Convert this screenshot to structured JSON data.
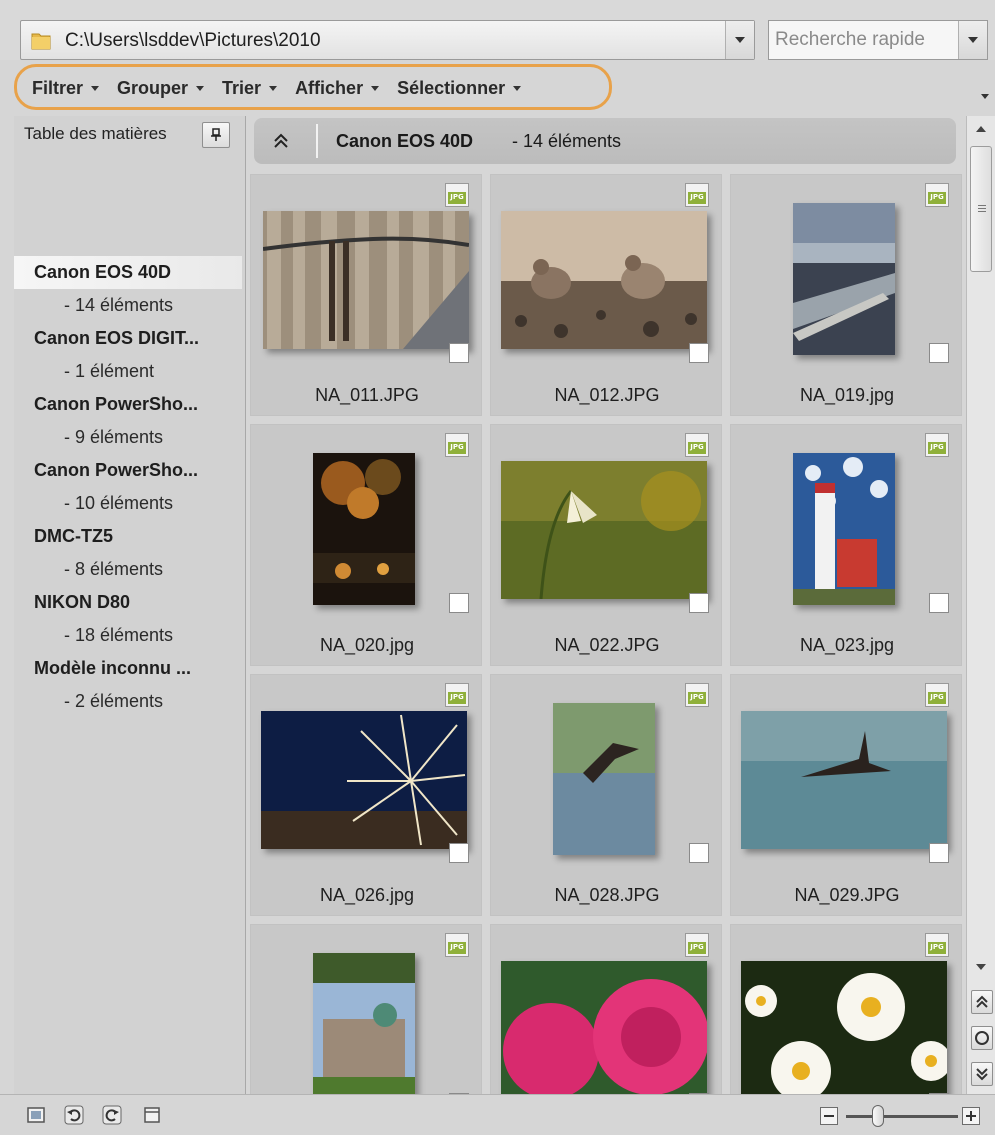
{
  "path_bar": {
    "path": "C:\\Users\\lsddev\\Pictures\\2010"
  },
  "search": {
    "placeholder": "Recherche rapide"
  },
  "toolbar": {
    "items": [
      {
        "label": "Filtrer"
      },
      {
        "label": "Grouper"
      },
      {
        "label": "Trier"
      },
      {
        "label": "Afficher"
      },
      {
        "label": "Sélectionner"
      }
    ]
  },
  "toc": {
    "header": "Table des matières",
    "entries": [
      {
        "name": "Canon EOS 40D",
        "count": "- 14 éléments"
      },
      {
        "name": "Canon EOS DIGIT...",
        "count": "- 1 élément"
      },
      {
        "name": "Canon PowerSho...",
        "count": "- 9 éléments"
      },
      {
        "name": "Canon PowerSho...",
        "count": "- 10 éléments"
      },
      {
        "name": "DMC-TZ5",
        "count": "- 8 éléments"
      },
      {
        "name": "NIKON D80",
        "count": "- 18 éléments"
      },
      {
        "name": "Modèle inconnu ...",
        "count": "- 2 éléments"
      }
    ]
  },
  "group": {
    "title": "Canon EOS 40D",
    "count": "- 14 éléments"
  },
  "thumbnails": [
    {
      "filename": "NA_011.JPG",
      "badge": "JPG"
    },
    {
      "filename": "NA_012.JPG",
      "badge": "JPG"
    },
    {
      "filename": "NA_019.jpg",
      "badge": "JPG"
    },
    {
      "filename": "NA_020.jpg",
      "badge": "JPG"
    },
    {
      "filename": "NA_022.JPG",
      "badge": "JPG"
    },
    {
      "filename": "NA_023.jpg",
      "badge": "JPG"
    },
    {
      "filename": "NA_026.jpg",
      "badge": "JPG"
    },
    {
      "filename": "NA_028.JPG",
      "badge": "JPG"
    },
    {
      "filename": "NA_029.JPG",
      "badge": "JPG"
    },
    {
      "filename": "",
      "badge": "JPG"
    },
    {
      "filename": "",
      "badge": "JPG"
    },
    {
      "filename": "",
      "badge": "JPG"
    }
  ],
  "colors": {
    "highlight": "#e8a24a",
    "jpg_badge": "#8fb03a"
  }
}
